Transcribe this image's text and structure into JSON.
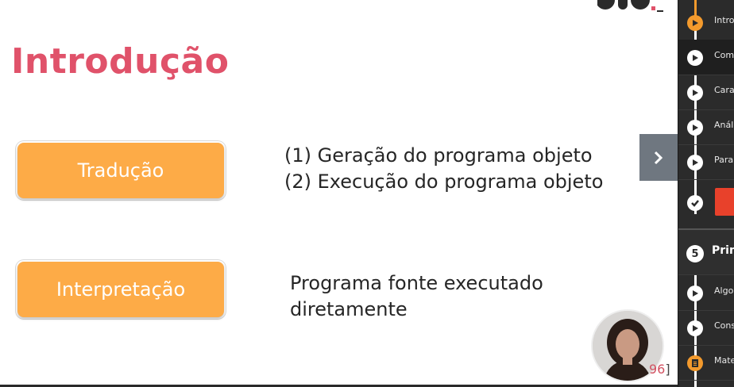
{
  "slide": {
    "title": "Introdução",
    "rows": [
      {
        "label": "Tradução",
        "lines": [
          "(1) Geração do programa objeto",
          "(2) Execução do programa objeto"
        ]
      },
      {
        "label": "Interpretação",
        "lines": [
          "Programa fonte executado",
          "diretamente"
        ]
      }
    ],
    "page_ref_num": "96",
    "page_ref_bracket": "]"
  },
  "sidebar": {
    "items": [
      {
        "label": "Intro",
        "icon": "play-icon"
      },
      {
        "label": "Com",
        "icon": "play-icon"
      },
      {
        "label": "Cara",
        "icon": "play-icon"
      },
      {
        "label": "Anál",
        "icon": "play-icon"
      },
      {
        "label": "Para",
        "icon": "play-icon"
      },
      {
        "label": "",
        "icon": "check-icon"
      }
    ],
    "section": {
      "number": "5",
      "label": "Prim"
    },
    "section_items": [
      {
        "label": "Algo",
        "icon": "play-icon"
      },
      {
        "label": "Cons",
        "icon": "play-icon"
      },
      {
        "label": "Mate",
        "icon": "document-icon"
      }
    ]
  },
  "colors": {
    "title": "#e0526a",
    "pill": "#fdab47",
    "sidebar_bg": "#2b2b2b",
    "progress_accent": "#f39a2d",
    "red_button": "#e8412b"
  }
}
